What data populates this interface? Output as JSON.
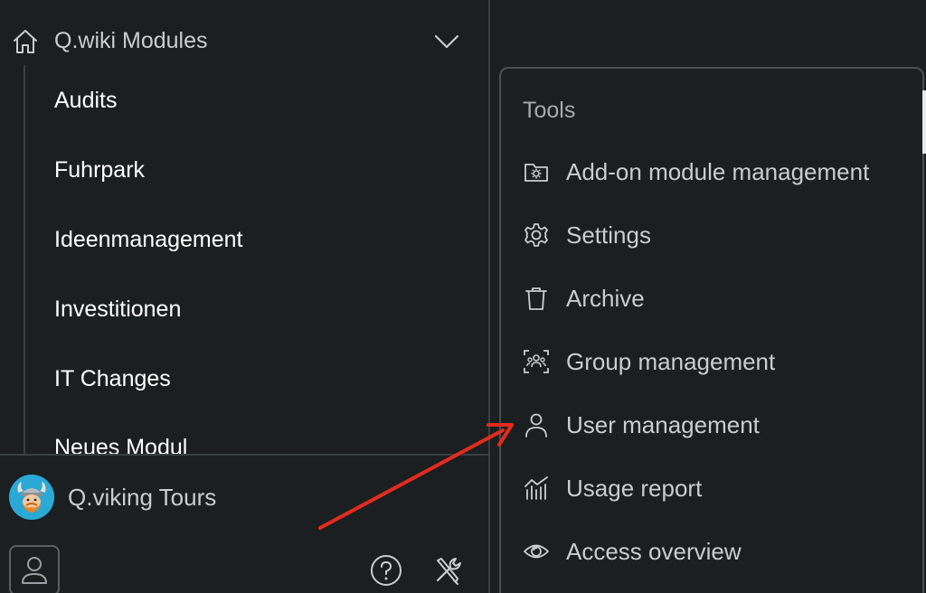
{
  "sidebar": {
    "header": {
      "title": "Q.wiki Modules",
      "icon": "home-icon",
      "toggle_icon": "chevron-down-icon"
    },
    "modules": [
      {
        "label": "Audits"
      },
      {
        "label": "Fuhrpark"
      },
      {
        "label": "Ideenmanagement"
      },
      {
        "label": "Investitionen"
      },
      {
        "label": "IT Changes"
      },
      {
        "label": "Neues Modul"
      }
    ],
    "workspace": {
      "name": "Q.viking Tours",
      "avatar": "viking-avatar"
    },
    "footer_icons": [
      "user-icon",
      "help-icon",
      "tools-icon"
    ]
  },
  "tools_menu": {
    "heading": "Tools",
    "items": [
      {
        "label": "Add-on module management",
        "icon": "folder-gear-icon"
      },
      {
        "label": "Settings",
        "icon": "gear-icon"
      },
      {
        "label": "Archive",
        "icon": "trash-icon"
      },
      {
        "label": "Group management",
        "icon": "group-icon"
      },
      {
        "label": "User management",
        "icon": "user-icon"
      },
      {
        "label": "Usage report",
        "icon": "chart-icon"
      },
      {
        "label": "Access overview",
        "icon": "eye-icon"
      }
    ]
  },
  "annotation": {
    "arrow_color": "#e32b1f",
    "points_to": "User management"
  },
  "colors": {
    "background": "#1b1f20",
    "text_primary": "#ffffff",
    "text_secondary": "#c9cdce",
    "divider": "#3a3f41"
  }
}
